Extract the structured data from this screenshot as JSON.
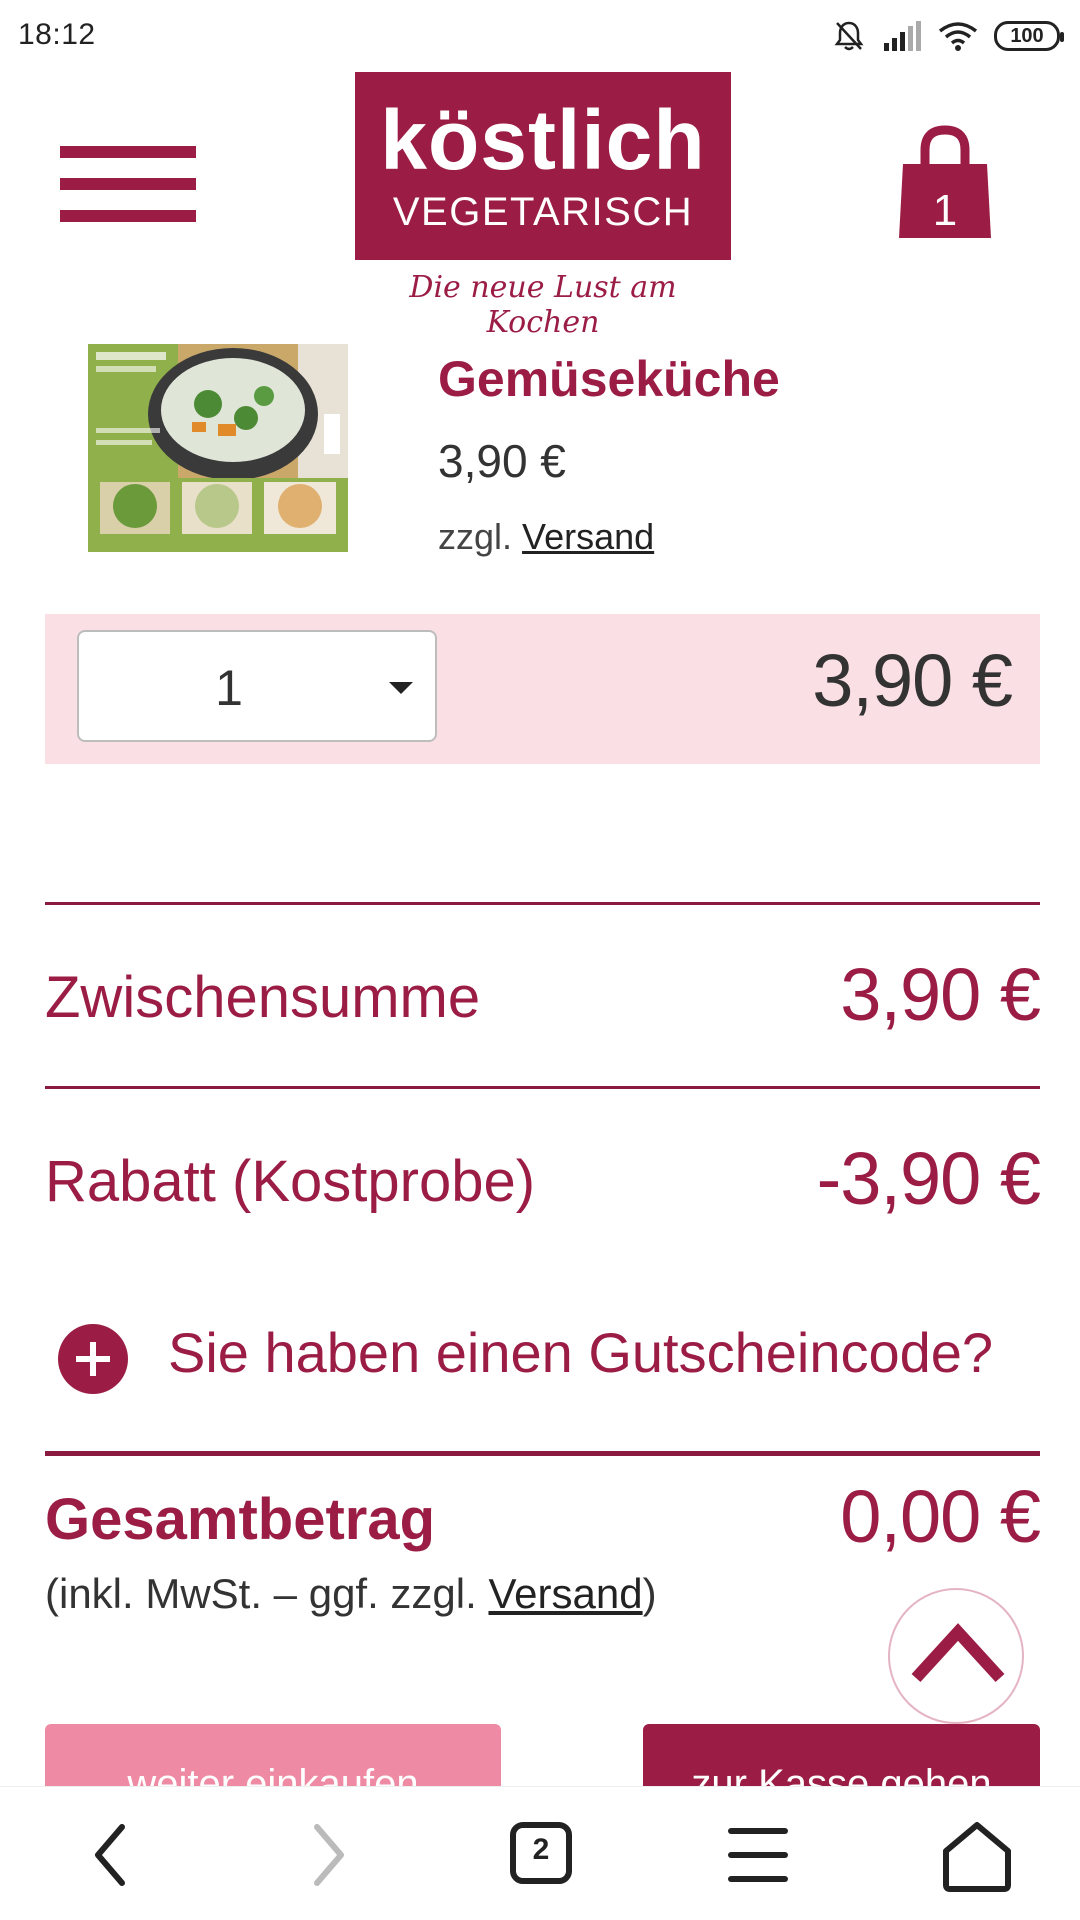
{
  "status_bar": {
    "time": "18:12",
    "icons": [
      "bell-off-icon",
      "signal-icon",
      "wifi-icon",
      "battery-icon"
    ],
    "battery": "100"
  },
  "header": {
    "logo_main": "köstlich",
    "logo_sub": "VEGETARISCH",
    "slogan": "Die neue Lust am Kochen",
    "cart_count": "1"
  },
  "product": {
    "name": "Gemüseküche",
    "price": "3,90 €",
    "shipping_prefix": "zzgl.",
    "shipping_link": "Versand"
  },
  "quantity": {
    "selected": "1",
    "line_total": "3,90 €"
  },
  "summary": {
    "subtotal_label": "Zwischensumme",
    "subtotal_value": "3,90 €",
    "discount_label": "Rabatt (Kostprobe)",
    "discount_value": "-3,90 €",
    "coupon_label": "Sie haben einen Gutscheincode?",
    "total_label": "Gesamtbetrag",
    "total_value": "0,00 €",
    "total_note_prefix": "(inkl. MwSt. – ggf. zzgl. ",
    "total_note_link": "Versand",
    "total_note_suffix": ")"
  },
  "buttons": {
    "continue_label": "weiter einkaufen",
    "checkout_label": "zur Kasse gehen"
  },
  "browser_nav": {
    "tab_count": "2"
  },
  "colors": {
    "brand": "#9b1d45",
    "pink_row": "#fadfe4",
    "continue_button": "#ee8aa3"
  }
}
